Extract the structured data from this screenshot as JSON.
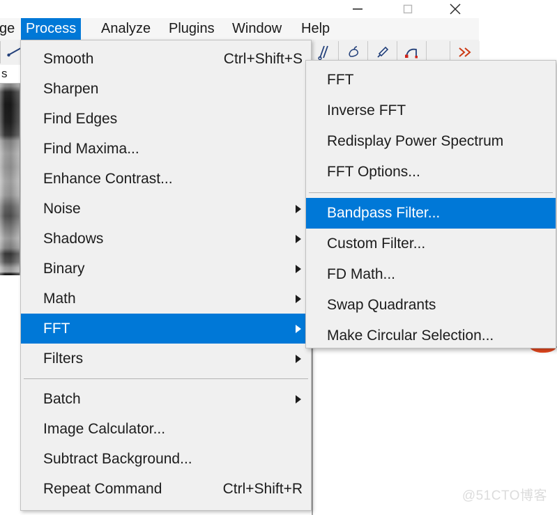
{
  "window": {
    "controls": [
      {
        "name": "minimize",
        "glyph": "—"
      },
      {
        "name": "maximize",
        "glyph": "□"
      },
      {
        "name": "close",
        "glyph": "✕"
      }
    ]
  },
  "menubar": {
    "items": [
      {
        "label": "ge",
        "selected": false
      },
      {
        "label": "Process",
        "selected": true
      },
      {
        "label": "Analyze",
        "selected": false
      },
      {
        "label": "Plugins",
        "selected": false
      },
      {
        "label": "Window",
        "selected": false
      },
      {
        "label": "Help",
        "selected": false
      }
    ]
  },
  "toolbar": {
    "tools": [
      {
        "name": "angle-tool"
      },
      {
        "name": "dropper-tool"
      },
      {
        "name": "wand-tool"
      },
      {
        "name": "line-points-tool"
      },
      {
        "name": "empty-tool"
      },
      {
        "name": "more-tools"
      }
    ],
    "more_label": "»"
  },
  "status": {
    "text": "s"
  },
  "process_menu": {
    "items": [
      {
        "label": "Smooth",
        "accel": "Ctrl+Shift+S",
        "submenu": false,
        "highlighted": false
      },
      {
        "label": "Sharpen",
        "accel": "",
        "submenu": false,
        "highlighted": false
      },
      {
        "label": "Find Edges",
        "accel": "",
        "submenu": false,
        "highlighted": false
      },
      {
        "label": "Find Maxima...",
        "accel": "",
        "submenu": false,
        "highlighted": false
      },
      {
        "label": "Enhance Contrast...",
        "accel": "",
        "submenu": false,
        "highlighted": false
      },
      {
        "label": "Noise",
        "accel": "",
        "submenu": true,
        "highlighted": false
      },
      {
        "label": "Shadows",
        "accel": "",
        "submenu": true,
        "highlighted": false
      },
      {
        "label": "Binary",
        "accel": "",
        "submenu": true,
        "highlighted": false
      },
      {
        "label": "Math",
        "accel": "",
        "submenu": true,
        "highlighted": false
      },
      {
        "label": "FFT",
        "accel": "",
        "submenu": true,
        "highlighted": true
      },
      {
        "label": "Filters",
        "accel": "",
        "submenu": true,
        "highlighted": false
      },
      {
        "separator": true
      },
      {
        "label": "Batch",
        "accel": "",
        "submenu": true,
        "highlighted": false
      },
      {
        "label": "Image Calculator...",
        "accel": "",
        "submenu": false,
        "highlighted": false
      },
      {
        "label": "Subtract Background...",
        "accel": "",
        "submenu": false,
        "highlighted": false
      },
      {
        "label": "Repeat Command",
        "accel": "Ctrl+Shift+R",
        "submenu": false,
        "highlighted": false
      }
    ]
  },
  "fft_submenu": {
    "items": [
      {
        "label": "FFT",
        "highlighted": false
      },
      {
        "label": "Inverse FFT",
        "highlighted": false
      },
      {
        "label": "Redisplay Power Spectrum",
        "highlighted": false
      },
      {
        "label": "FFT Options...",
        "highlighted": false
      },
      {
        "separator": true
      },
      {
        "label": "Bandpass Filter...",
        "highlighted": true
      },
      {
        "label": "Custom Filter...",
        "highlighted": false
      },
      {
        "label": "FD Math...",
        "highlighted": false
      },
      {
        "label": "Swap Quadrants",
        "highlighted": false
      },
      {
        "label": "Make Circular Selection...",
        "highlighted": false
      }
    ]
  },
  "watermark": {
    "text": "@51CTO博客"
  },
  "colors": {
    "highlight": "#0078d7",
    "menu_background": "#f0f0f0",
    "menu_text": "#1c1c1c",
    "annotation": "#e8491f"
  }
}
